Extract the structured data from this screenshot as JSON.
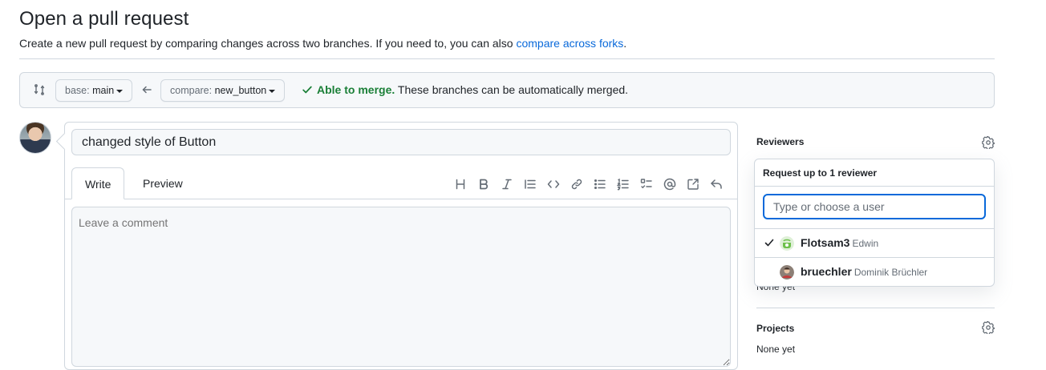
{
  "header": {
    "title": "Open a pull request",
    "subtitle_prefix": "Create a new pull request by comparing changes across two branches. If you need to, you can also",
    "subtitle_link": "compare across forks",
    "subtitle_suffix": "."
  },
  "compare_bar": {
    "base_label": "base:",
    "base_value": "main",
    "compare_label": "compare:",
    "compare_value": "new_button",
    "merge_ok": "Able to merge.",
    "merge_detail": "These branches can be automatically merged."
  },
  "editor": {
    "title_value": "changed style of Button",
    "tab_write": "Write",
    "tab_preview": "Preview",
    "comment_placeholder": "Leave a comment",
    "toolbar_icons": [
      "heading-icon",
      "bold-icon",
      "italic-icon",
      "quote-icon",
      "code-icon",
      "link-icon",
      "unordered-list-icon",
      "ordered-list-icon",
      "task-list-icon",
      "mention-icon",
      "cross-reference-icon",
      "reply-icon"
    ]
  },
  "sidebar": {
    "reviewers_title": "Reviewers",
    "reviewers_none": "None yet",
    "projects_title": "Projects",
    "projects_none": "None yet"
  },
  "reviewer_popover": {
    "header": "Request up to 1 reviewer",
    "search_placeholder": "Type or choose a user",
    "users": [
      {
        "login": "Flotsam3",
        "name": "Edwin",
        "selected": true
      },
      {
        "login": "bruechler",
        "name": "Dominik Brüchler",
        "selected": false
      }
    ]
  },
  "colors": {
    "link": "#0969da",
    "success": "#1a7f37",
    "border": "#d0d7de",
    "muted": "#656d76"
  }
}
